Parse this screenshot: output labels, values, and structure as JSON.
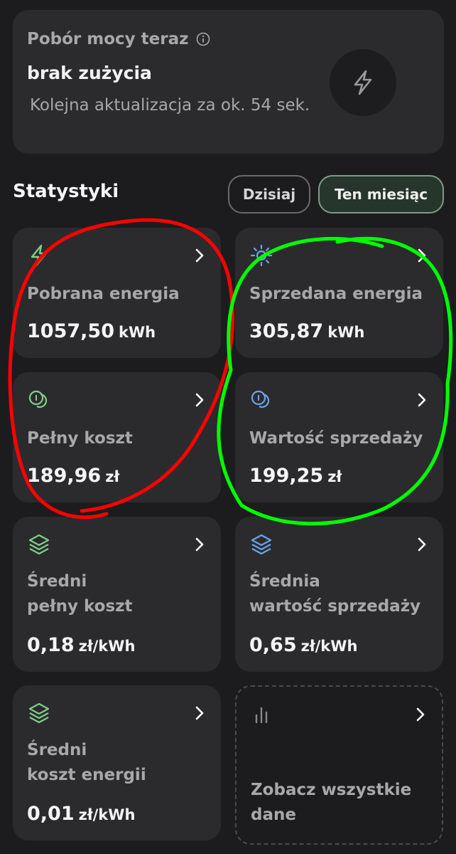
{
  "power": {
    "title": "Pobór mocy teraz",
    "status": "brak zużycia",
    "update": "Kolejna aktualizacja za ok. 54 sek."
  },
  "stats": {
    "title": "Statystyki",
    "filters": [
      "Dzisiaj",
      "Ten miesiąc"
    ],
    "selected": "Ten miesiąc",
    "cards": [
      {
        "label": "Pobrana energia",
        "value": "1057,50",
        "unit": "kWh",
        "icon": "bolt-icon"
      },
      {
        "label": "Sprzedana energia",
        "value": "305,87",
        "unit": "kWh",
        "icon": "sun-icon"
      },
      {
        "label": "Pełny koszt",
        "value": "189,96",
        "unit": "zł",
        "icon": "coins-icon"
      },
      {
        "label": "Wartość sprzedaży",
        "value": "199,25",
        "unit": "zł",
        "icon": "coins-icon"
      },
      {
        "label1": "Średni",
        "label2": "pełny koszt",
        "value": "0,18",
        "unit": "zł/kWh",
        "icon": "layers-icon"
      },
      {
        "label1": "Średnia",
        "label2": "wartość sprzedaży",
        "value": "0,65",
        "unit": "zł/kWh",
        "icon": "layers-icon"
      },
      {
        "label1": "Średni",
        "label2": "koszt energii",
        "value": "0,01",
        "unit": "zł/kWh",
        "icon": "layers-icon"
      }
    ],
    "see_all": {
      "line1": "Zobacz wszystkie",
      "line2": "dane",
      "icon": "bar-chart-icon"
    }
  },
  "colors": {
    "green": "#7fcf8b",
    "blue": "#6aa5e8",
    "annotation_red": "#ff0000",
    "annotation_green": "#00ff00"
  }
}
